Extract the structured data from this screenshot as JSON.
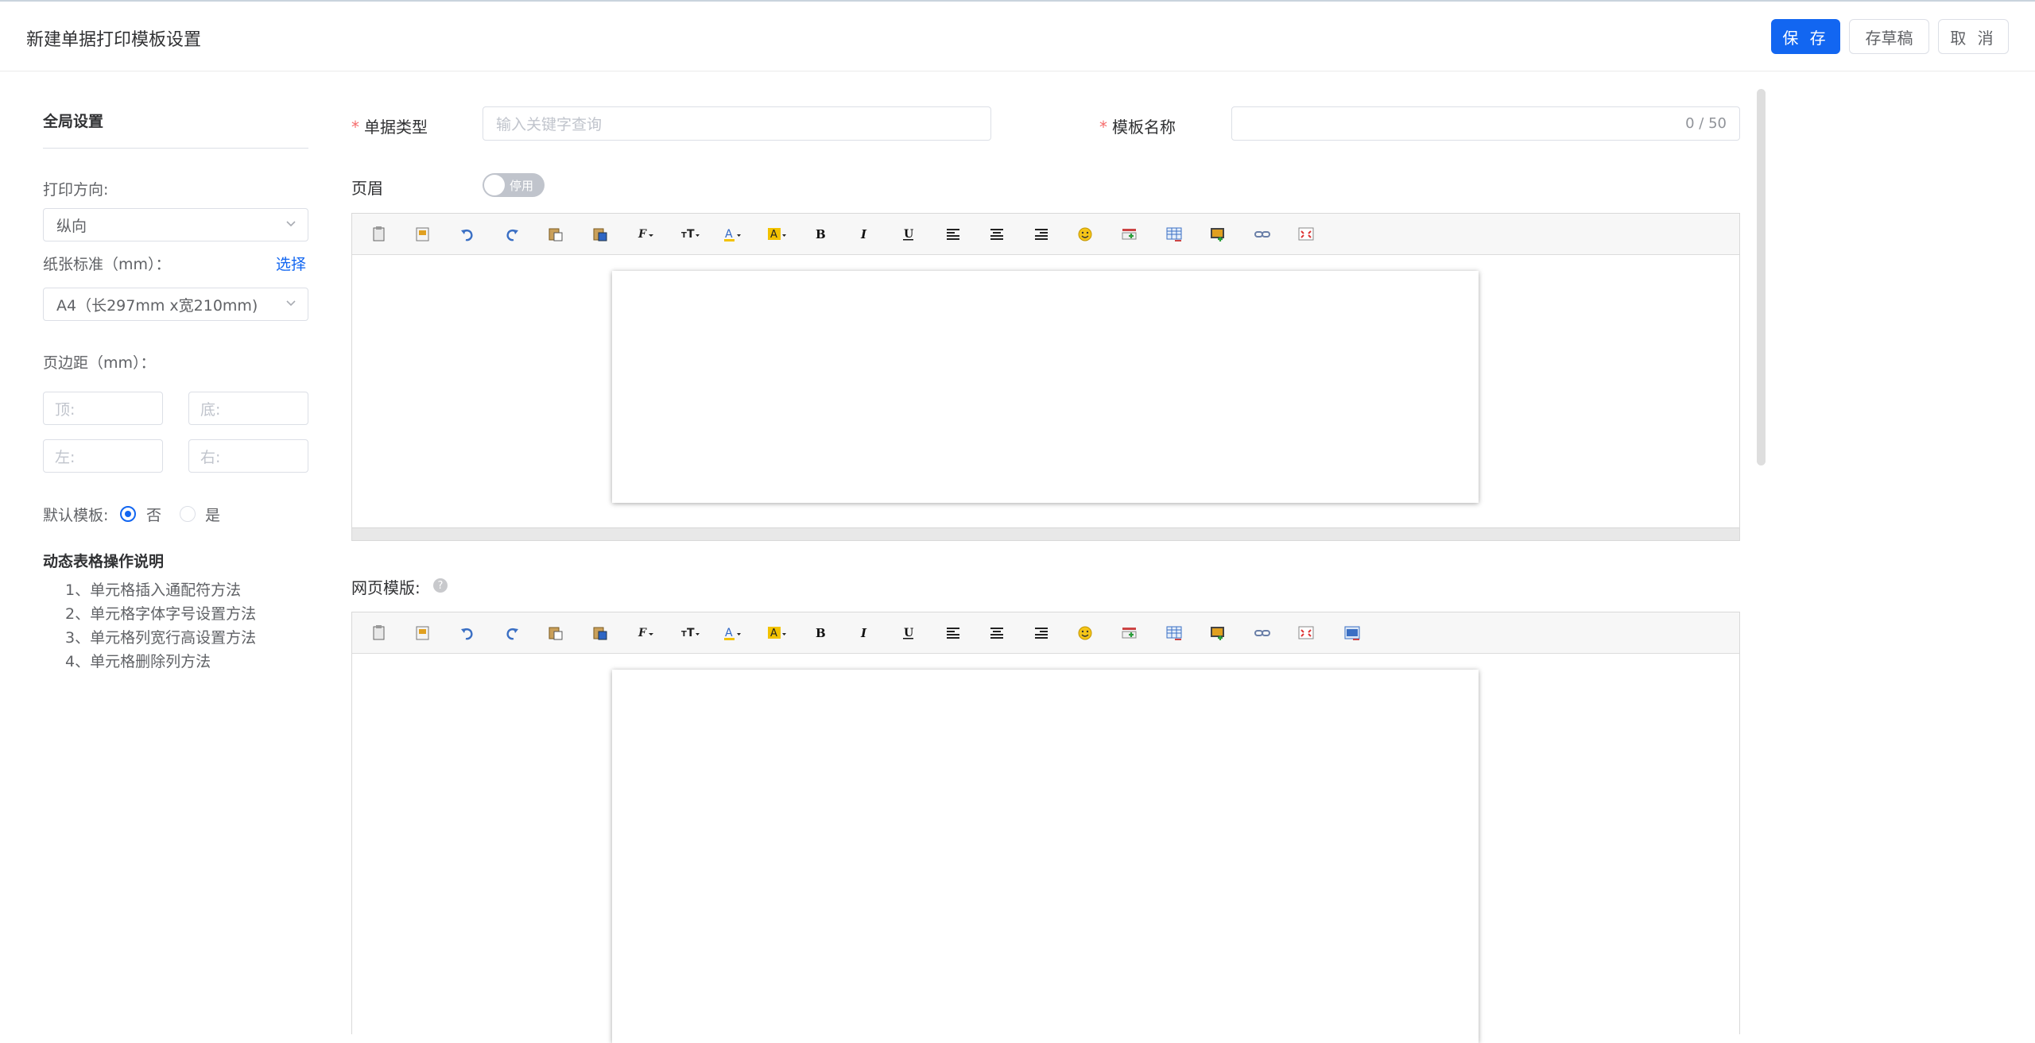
{
  "header": {
    "title": "新建单据打印模板设置",
    "save_label": "保 存",
    "draft_label": "存草稿",
    "cancel_label": "取 消"
  },
  "global_settings": {
    "title": "全局设置",
    "orientation_label": "打印方向:",
    "orientation_value": "纵向",
    "paper_label": "纸张标准（mm）：",
    "paper_select_link": "选择",
    "paper_value": "A4（长297mm x宽210mm)",
    "margin_label": "页边距（mm）：",
    "margin_top_placeholder": "顶:",
    "margin_bottom_placeholder": "底:",
    "margin_left_placeholder": "左:",
    "margin_right_placeholder": "右:",
    "default_template_label": "默认模板:",
    "default_no": "否",
    "default_yes": "是",
    "default_selected": "否"
  },
  "help": {
    "title": "动态表格操作说明",
    "items": [
      "1、单元格插入通配符方法",
      "2、单元格字体字号设置方法",
      "3、单元格列宽行高设置方法",
      "4、单元格删除列方法"
    ]
  },
  "form": {
    "doc_type_label": "单据类型",
    "doc_type_placeholder": "输入关键字查询",
    "template_name_label": "模板名称",
    "template_name_counter": "0 / 50",
    "header_label": "页眉",
    "header_toggle_label": "停用",
    "header_toggle_on": false,
    "web_template_label": "网页模版:",
    "help_icon": "?"
  },
  "toolbar_icons": [
    "clipboard-icon",
    "template-icon",
    "undo-icon",
    "redo-icon",
    "paste-icon",
    "paste-word-icon",
    "font-family-icon",
    "font-size-icon",
    "font-color-icon",
    "highlight-icon",
    "bold-icon",
    "italic-icon",
    "underline-icon",
    "align-left-icon",
    "align-center-icon",
    "align-right-icon",
    "emoji-icon",
    "insert-row-icon",
    "table-icon",
    "image-icon",
    "link-icon",
    "fullscreen-icon",
    "preview-icon"
  ],
  "colors": {
    "primary": "#1266f1",
    "required": "#f56c6c"
  }
}
